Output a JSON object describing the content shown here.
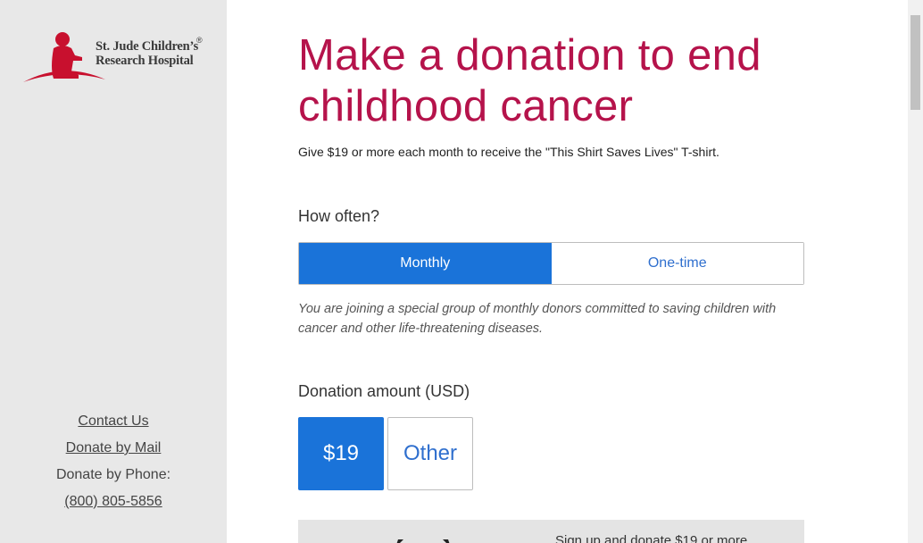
{
  "sidebar": {
    "logo_line1": "St. Jude Children’s",
    "logo_line2": "Research Hospital",
    "logo_reg": "®",
    "links": {
      "contact": "Contact Us",
      "mail": "Donate by Mail",
      "phone_label": "Donate by Phone:",
      "phone": "(800) 805-5856"
    }
  },
  "main": {
    "title": "Make a donation to end childhood cancer",
    "subtitle": "Give $19 or more each month to receive the \"This Shirt Saves Lives\" T-shirt.",
    "frequency": {
      "label": "How often?",
      "options": [
        "Monthly",
        "One-time"
      ],
      "selected": "Monthly",
      "note": "You are joining a special group of monthly donors committed to saving children with cancer and other life-threatening diseases."
    },
    "amount": {
      "label": "Donation amount (USD)",
      "options": [
        "$19",
        "Other"
      ],
      "selected": "$19"
    },
    "promo_text": "Sign up and donate $19 or more"
  },
  "colors": {
    "brand": "#b5134b",
    "accent": "#1a73d9",
    "sidebar_bg": "#e8e8e8"
  }
}
